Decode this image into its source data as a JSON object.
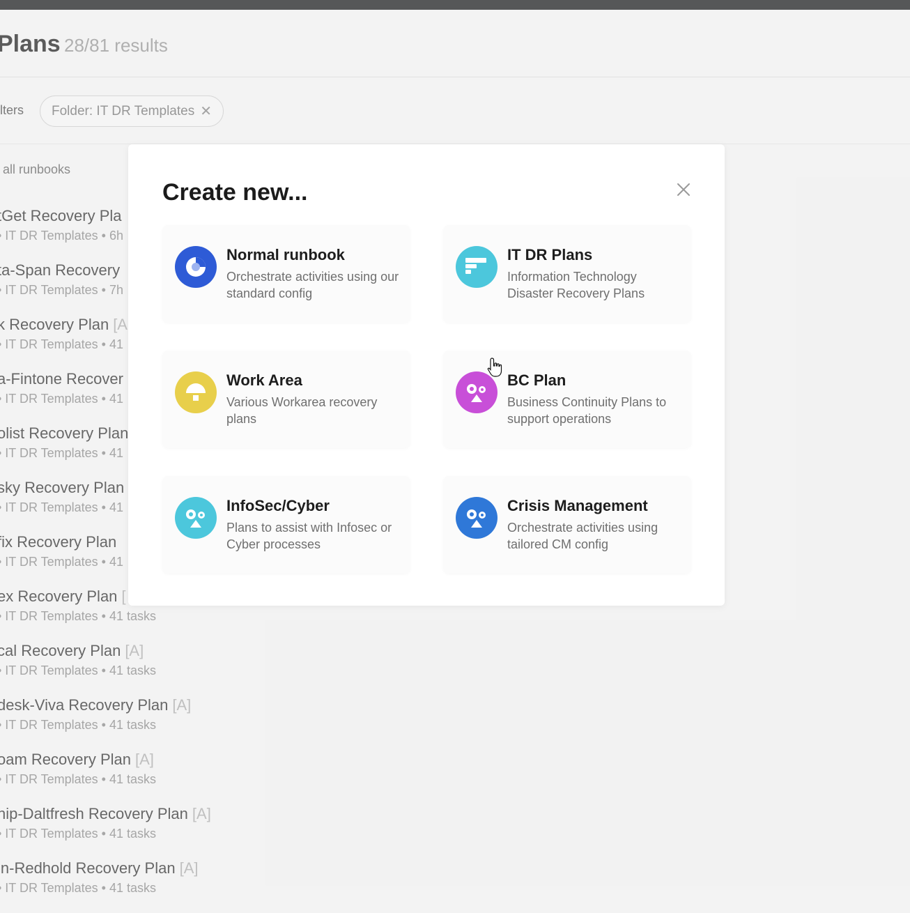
{
  "header": {
    "title": "Plans",
    "results": "28/81 results"
  },
  "filters": {
    "label": "ilters",
    "chip_label": "Folder: IT DR Templates",
    "chip_close": "✕"
  },
  "list": {
    "all_runbooks": ": all runbooks",
    "items": [
      {
        "name": "tGet Recovery Pla",
        "tag": "",
        "meta": "• IT DR Templates • 6h"
      },
      {
        "name": "ta-Span Recovery",
        "tag": "",
        "meta": "• IT DR Templates • 7h"
      },
      {
        "name": "k Recovery Plan",
        "tag": "[A",
        "meta": "• IT DR Templates • 41"
      },
      {
        "name": "a-Fintone Recover",
        "tag": "",
        "meta": "• IT DR Templates • 41"
      },
      {
        "name": "olist Recovery Plan",
        "tag": "",
        "meta": "• IT DR Templates • 41"
      },
      {
        "name": "sky Recovery Plan",
        "tag": "",
        "meta": "• IT DR Templates • 41"
      },
      {
        "name": "fix Recovery Plan",
        "tag": "",
        "meta": "• IT DR Templates • 41"
      },
      {
        "name": "ex Recovery Plan",
        "tag": "[",
        "meta": "• IT DR Templates • 41 tasks"
      },
      {
        "name": "cal Recovery Plan",
        "tag": "[A]",
        "meta": "• IT DR Templates • 41 tasks"
      },
      {
        "name": "desk-Viva Recovery Plan",
        "tag": "[A]",
        "meta": "• IT DR Templates • 41 tasks"
      },
      {
        "name": "oam Recovery Plan",
        "tag": "[A]",
        "meta": "• IT DR Templates • 41 tasks"
      },
      {
        "name": "nip-Daltfresh Recovery Plan",
        "tag": "[A]",
        "meta": "• IT DR Templates • 41 tasks"
      },
      {
        "name": "in-Redhold Recovery Plan",
        "tag": "[A]",
        "meta": "• IT DR Templates • 41 tasks"
      }
    ]
  },
  "modal": {
    "title": "Create new...",
    "options": [
      {
        "title": "Normal runbook",
        "desc": "Orchestrate activities using our standard config",
        "icon": "normal-runbook-icon",
        "color": "#2e5bd6"
      },
      {
        "title": "IT DR Plans",
        "desc": "Information Technology Disaster Recovery Plans",
        "icon": "it-dr-plans-icon",
        "color": "#4cc7dc"
      },
      {
        "title": "Work Area",
        "desc": "Various Workarea recovery plans",
        "icon": "work-area-icon",
        "color": "#e8cf4b"
      },
      {
        "title": "BC Plan",
        "desc": "Business Continuity Plans to support operations",
        "icon": "bc-plan-icon",
        "color": "#c84fd8"
      },
      {
        "title": "InfoSec/Cyber",
        "desc": "Plans to assist with Infosec or Cyber processes",
        "icon": "infosec-cyber-icon",
        "color": "#4cc7dc"
      },
      {
        "title": "Crisis Management",
        "desc": "Orchestrate activities using tailored CM config",
        "icon": "crisis-management-icon",
        "color": "#2f78d8"
      }
    ]
  }
}
